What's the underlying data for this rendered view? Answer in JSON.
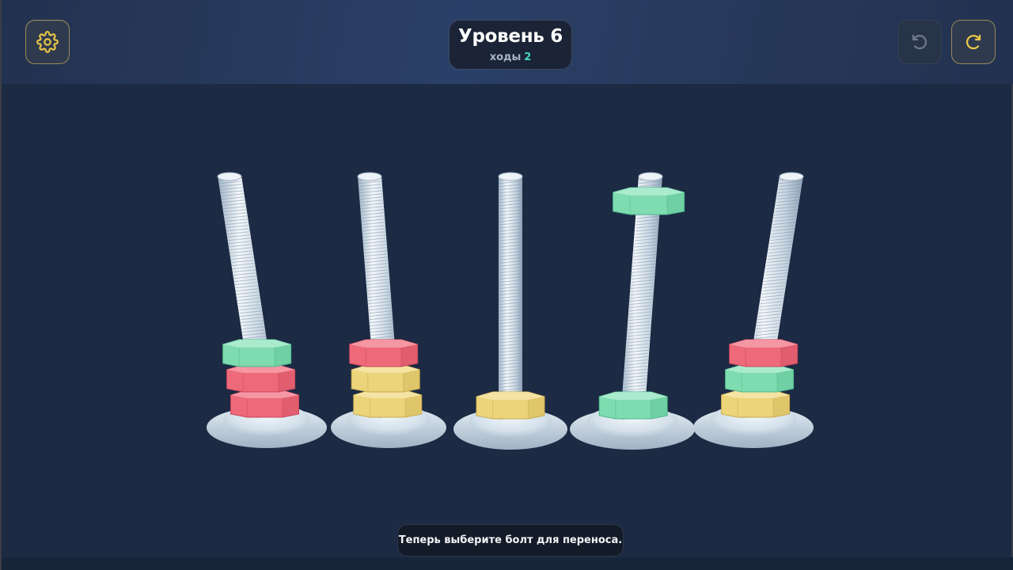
{
  "header": {
    "level_title": "Уровень 6",
    "moves_label": "ходы",
    "moves_count": "2"
  },
  "buttons": {
    "settings_icon": "gear-icon",
    "undo_icon": "undo-icon",
    "restart_icon": "restart-icon",
    "undo_enabled": false
  },
  "hint": {
    "text": "Теперь выберите болт для переноса."
  },
  "colors": {
    "accent": "#e8c547",
    "moves_accent": "#46d6c3",
    "nut_green": "#7fdcb0",
    "nut_red": "#ee6a7a",
    "nut_yellow": "#ecd47a"
  },
  "bolts": [
    {
      "nuts_bottom_to_top": [
        "red",
        "red",
        "green"
      ],
      "lifted": null
    },
    {
      "nuts_bottom_to_top": [
        "yellow",
        "yellow",
        "red"
      ],
      "lifted": null
    },
    {
      "nuts_bottom_to_top": [
        "yellow"
      ],
      "lifted": null
    },
    {
      "nuts_bottom_to_top": [
        "green"
      ],
      "lifted": "green"
    },
    {
      "nuts_bottom_to_top": [
        "yellow",
        "green",
        "red"
      ],
      "lifted": null
    }
  ]
}
